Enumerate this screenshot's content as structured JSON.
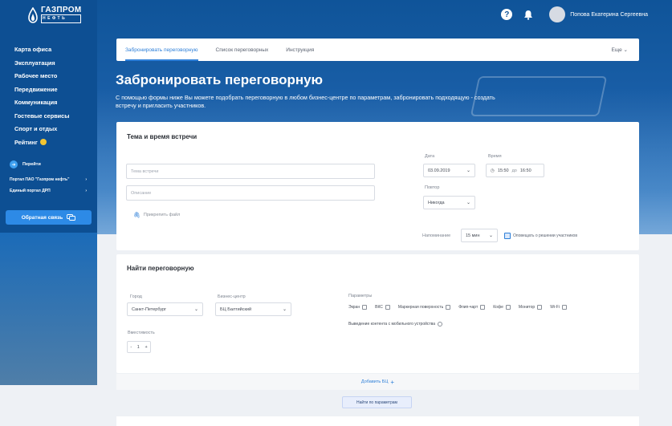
{
  "brand": {
    "logo_text": "ГАЗПРОМ",
    "logo_sub": "НЕФТЬ"
  },
  "sidebar": {
    "items": [
      {
        "label": "Карта офиса"
      },
      {
        "label": "Эксплуатация"
      },
      {
        "label": "Рабочее место"
      },
      {
        "label": "Передвижение"
      },
      {
        "label": "Коммуникация"
      },
      {
        "label": "Гостевые сервисы"
      },
      {
        "label": "Спорт и отдых"
      },
      {
        "label": "Рейтинг"
      }
    ],
    "goto_label": "Перейти",
    "portals": [
      {
        "label": "Портал ПАО \"Газпром нефть\""
      },
      {
        "label": "Единый портал ДРП"
      }
    ],
    "feedback_label": "Обратная связь"
  },
  "header": {
    "user_name": "Попова Екатерина Сергеевна"
  },
  "tabs": [
    {
      "label": "Забронировать переговорную",
      "active": true
    },
    {
      "label": "Список переговорных",
      "active": false
    },
    {
      "label": "Инструкция",
      "active": false
    }
  ],
  "tabs_more": "Еще",
  "page": {
    "title": "Забронировать переговорную",
    "description": "С помощью формы ниже Вы можете подобрать переговорную в любом бизнес-центре по параметрам, забронировать подходящую - создать встречу и пригласить участников."
  },
  "meeting": {
    "section_title": "Тема и время встречи",
    "topic_placeholder": "Тема встречи",
    "description_placeholder": "Описание",
    "attach_label": "Прикрепить файл",
    "date_label": "Дата",
    "date_value": "03.09.2019",
    "time_label": "Время",
    "time_from": "15:50",
    "time_sep": "до",
    "time_to": "16:50",
    "repeat_label": "Повтор",
    "repeat_value": "Никогда",
    "remind_label": "Напоминание",
    "remind_value": "15 мин",
    "remind_check_label": "Оповещать о решении участников"
  },
  "find": {
    "section_title": "Найти переговорную",
    "city_label": "Город",
    "city_value": "Санкт-Петербург",
    "bc_label": "Бизнес-центр",
    "bc_value": "БЦ Балтийский",
    "capacity_label": "Вместимость",
    "capacity_value": "1",
    "params_label": "Параметры",
    "params": [
      {
        "label": "Экран"
      },
      {
        "label": "ВКС"
      },
      {
        "label": "Маркерная поверхность"
      },
      {
        "label": "Флип-чарт"
      },
      {
        "label": "Кофе"
      },
      {
        "label": "Монитор"
      },
      {
        "label": "Wi-Fi"
      }
    ],
    "mobile_label": "Выведение контента с мобильного устройства",
    "add_bc_label": "Добавить БЦ",
    "search_button": "Найти по параметрам"
  }
}
